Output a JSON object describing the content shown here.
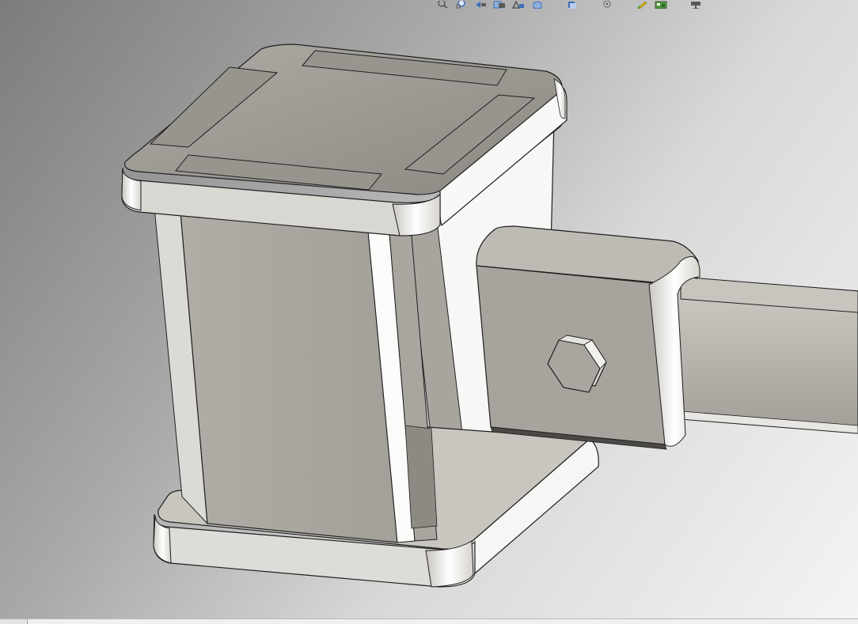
{
  "viewport": {
    "background_top": "#7c7c7c",
    "background_bottom": "#f4f4f4"
  },
  "heads_up_toolbar": {
    "icons": [
      "zoom-to-fit-icon",
      "zoom-to-area-icon",
      "previous-view-icon",
      "section-view-icon",
      "dynamic-annotation-icon",
      "view-orientation-icon",
      "display-style-icon",
      "hide-show-items-icon",
      "edit-appearance-icon",
      "apply-scene-icon",
      "view-settings-icon"
    ],
    "colors": {
      "icon_blue": "#3b6fb8",
      "icon_gray": "#5a5a5a",
      "icon_green": "#4f9a3a",
      "icon_yellow": "#e2c21d"
    }
  },
  "model": {
    "face_light": "#f6f6f4",
    "face_mid": "#a9a7a1",
    "face_dark": "#8e8b85",
    "edge_color": "#1f1f1f"
  },
  "status_bar": {
    "tab_icon": "status-tab-icon"
  }
}
